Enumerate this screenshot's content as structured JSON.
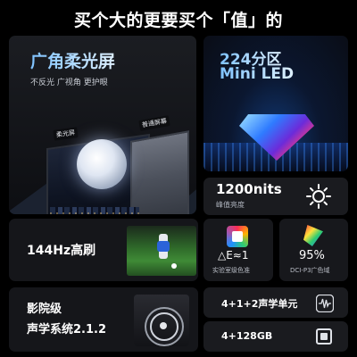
{
  "headline": "买个大的更要买个「值」的",
  "wide_angle_screen": {
    "title": "广角柔光屏",
    "subtitle": "不反光 广视角 更护眼",
    "tag_left": "柔光屏",
    "tag_right": "普通屏幕"
  },
  "mini_led": {
    "line1": "224分区",
    "line2": "Mini LED",
    "accent_color": "#7ec2ff"
  },
  "brightness": {
    "value": "1200nits",
    "label": "峰值亮度",
    "icon": "sun-icon"
  },
  "refresh": {
    "title": "144Hz高刷"
  },
  "color_accuracy": {
    "value": "△E≈1",
    "label": "实验室级色准",
    "icon": "palette-icon"
  },
  "color_gamut": {
    "value": "95%",
    "label": "DCI-P3广色域",
    "icon": "gamut-icon"
  },
  "cinema_audio": {
    "line1": "影院级",
    "line2": "声学系统2.1.2"
  },
  "speaker_units": {
    "value": "4+1+2声学单元",
    "icon": "waveform-icon"
  },
  "storage": {
    "value": "4+128GB",
    "icon": "chip-icon"
  }
}
